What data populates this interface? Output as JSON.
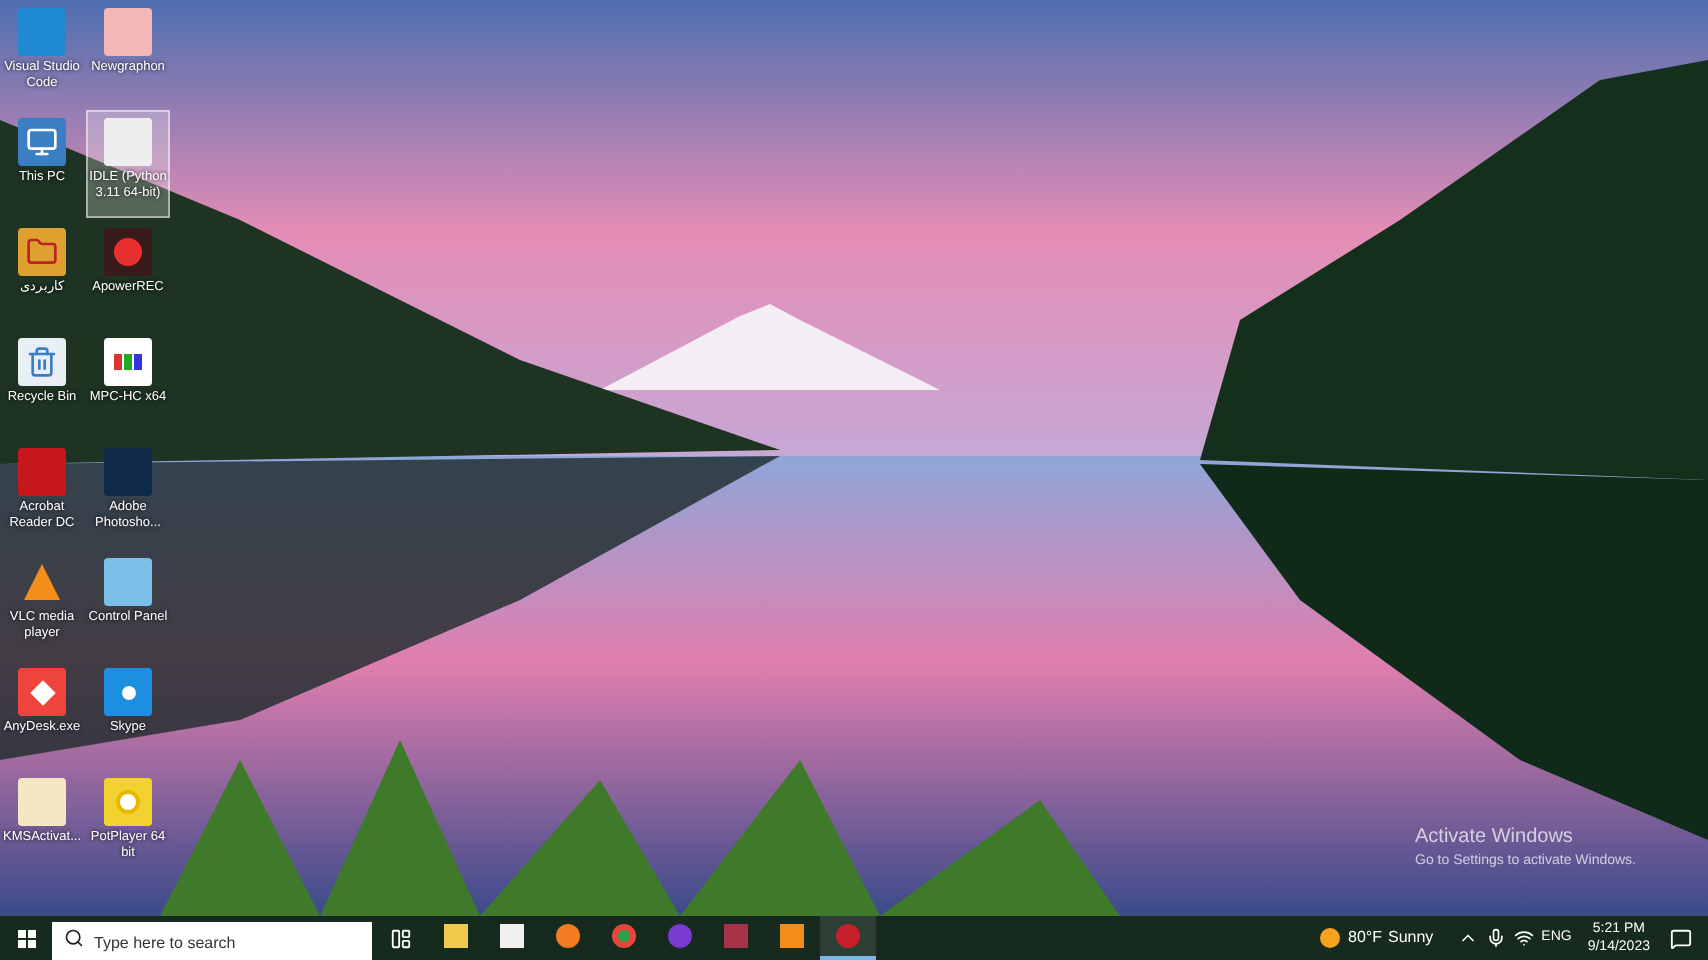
{
  "desktop_icons": [
    {
      "label": "Visual Studio Code",
      "selected": false
    },
    {
      "label": "Newgraphon",
      "selected": false
    },
    {
      "label": "This PC",
      "selected": false
    },
    {
      "label": "IDLE (Python 3.11 64-bit)",
      "selected": true
    },
    {
      "label": "کاربردی",
      "selected": false
    },
    {
      "label": "ApowerREC",
      "selected": false
    },
    {
      "label": "Recycle Bin",
      "selected": false
    },
    {
      "label": "MPC-HC x64",
      "selected": false
    },
    {
      "label": "Acrobat Reader DC",
      "selected": false
    },
    {
      "label": "Adobe Photosho...",
      "selected": false
    },
    {
      "label": "VLC media player",
      "selected": false
    },
    {
      "label": "Control Panel",
      "selected": false
    },
    {
      "label": "AnyDesk.exe",
      "selected": false
    },
    {
      "label": "Skype",
      "selected": false
    },
    {
      "label": "KMSActivat...",
      "selected": false
    },
    {
      "label": "PotPlayer 64 bit",
      "selected": false
    }
  ],
  "activation_notice": {
    "title": "Activate Windows",
    "subtitle": "Go to Settings to activate Windows."
  },
  "taskbar": {
    "search": {
      "placeholder": "Type here to search"
    },
    "pinned_apps": [
      {
        "selected": false
      },
      {
        "selected": false
      },
      {
        "selected": false
      },
      {
        "selected": false
      },
      {
        "selected": false
      },
      {
        "selected": false
      },
      {
        "selected": false
      },
      {
        "selected": true
      }
    ],
    "weather": {
      "temperature": "80°F",
      "condition": "Sunny"
    },
    "language": "ENG",
    "time": "5:21 PM",
    "date": "9/14/2023"
  }
}
